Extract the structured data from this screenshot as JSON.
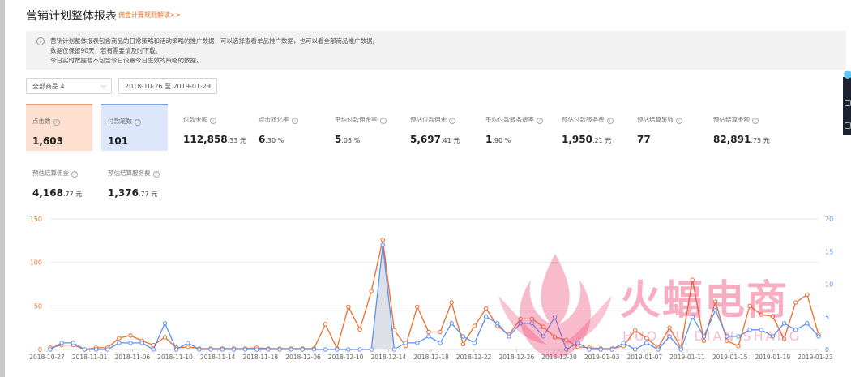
{
  "header": {
    "title": "营销计划整体报表",
    "link": "佣金计算规则解读>>"
  },
  "notice": {
    "icon": "info-icon",
    "lines": [
      "营销计划整体报表包含商品的日常策略和活动策略的推广数据，可以选择查看单品推广数据，也可以看全部商品推广数据。",
      "数据仅保留90天，若有需要请及时下载。",
      "今日实时数据暂不包含今日设置今日生效的策略的数据。"
    ]
  },
  "filters": {
    "product": "全部商品 4",
    "date_range": "2018-10-26 至 2019-01-23"
  },
  "metrics": [
    {
      "label": "点击数",
      "value": "1,603",
      "suffix": ""
    },
    {
      "label": "付款笔数",
      "value": "101",
      "suffix": ""
    },
    {
      "label": "付款金额",
      "value": "112,858",
      "suffix": ".33 元"
    },
    {
      "label": "点击转化率",
      "value": "6",
      "suffix": ".30 %"
    },
    {
      "label": "平均付款佣金率",
      "value": "5",
      "suffix": ".05 %"
    },
    {
      "label": "预估付款佣金",
      "value": "5,697",
      "suffix": ".41 元"
    },
    {
      "label": "平均付款服务费率",
      "value": "1",
      "suffix": ".90 %"
    },
    {
      "label": "预估付款服务费",
      "value": "1,950",
      "suffix": ".21 元"
    },
    {
      "label": "预估结算笔数",
      "value": "77",
      "suffix": ""
    },
    {
      "label": "预估结算金额",
      "value": "82,891",
      "suffix": ".75 元"
    },
    {
      "label": "预估结算佣金",
      "value": "4,168",
      "suffix": ".77 元"
    },
    {
      "label": "预估结算服务费",
      "value": "1,376",
      "suffix": ".77 元"
    }
  ],
  "watermark": {
    "text": "火蝠电商",
    "sub": "HUO FU DIAN SHANG"
  },
  "colors": {
    "orange_series": "#f06a2a",
    "blue_series": "#5b8ff0",
    "accent": "#f56a1d"
  },
  "chart_data": {
    "type": "line",
    "x_tick_labels": [
      "2018-10-27",
      "2018-11-01",
      "2018-11-06",
      "2018-11-10",
      "2018-11-14",
      "2018-11-18",
      "2018-12-06",
      "2018-12-10",
      "2018-12-14",
      "2018-12-18",
      "2018-12-22",
      "2018-12-26",
      "2018-12-30",
      "2019-01-03",
      "2019-01-07",
      "2019-01-11",
      "2019-01-15",
      "2019-01-19",
      "2019-01-23"
    ],
    "y_left": {
      "min": 0,
      "max": 150,
      "ticks": [
        0,
        50,
        100,
        150
      ]
    },
    "y_right": {
      "min": 0,
      "max": 20,
      "ticks": [
        0,
        5,
        10,
        15,
        20
      ]
    },
    "series": [
      {
        "axis": "left",
        "color": "#f06a2a",
        "values": [
          2,
          5,
          5,
          0,
          2,
          2,
          13,
          16,
          10,
          5,
          14,
          2,
          3,
          1,
          1,
          1,
          1,
          1,
          2,
          1,
          1,
          1,
          1,
          1,
          29,
          1,
          49,
          23,
          67,
          126,
          22,
          4,
          49,
          20,
          20,
          54,
          6,
          27,
          47,
          27,
          17,
          35,
          35,
          26,
          14,
          11,
          3,
          2,
          1,
          1,
          4,
          22,
          13,
          2,
          25,
          2,
          80,
          10,
          55,
          10,
          4,
          50,
          40,
          38,
          12,
          54,
          63,
          17
        ]
      },
      {
        "axis": "right",
        "color": "#5b8ff0",
        "values": [
          0,
          1,
          1,
          0,
          0,
          0,
          1,
          1,
          1,
          0,
          4,
          0,
          1,
          0,
          0,
          0,
          0,
          0,
          0,
          0,
          0,
          0,
          0,
          0,
          0,
          0,
          0,
          0,
          0,
          16,
          0,
          1,
          1,
          2,
          1,
          4,
          2,
          1,
          5,
          4,
          2,
          4,
          4,
          2,
          5,
          0,
          1,
          0,
          0,
          0,
          1,
          0,
          1,
          0,
          2,
          0,
          5,
          2,
          6,
          2,
          2,
          3,
          3,
          2,
          4,
          3,
          4,
          2
        ]
      }
    ]
  }
}
